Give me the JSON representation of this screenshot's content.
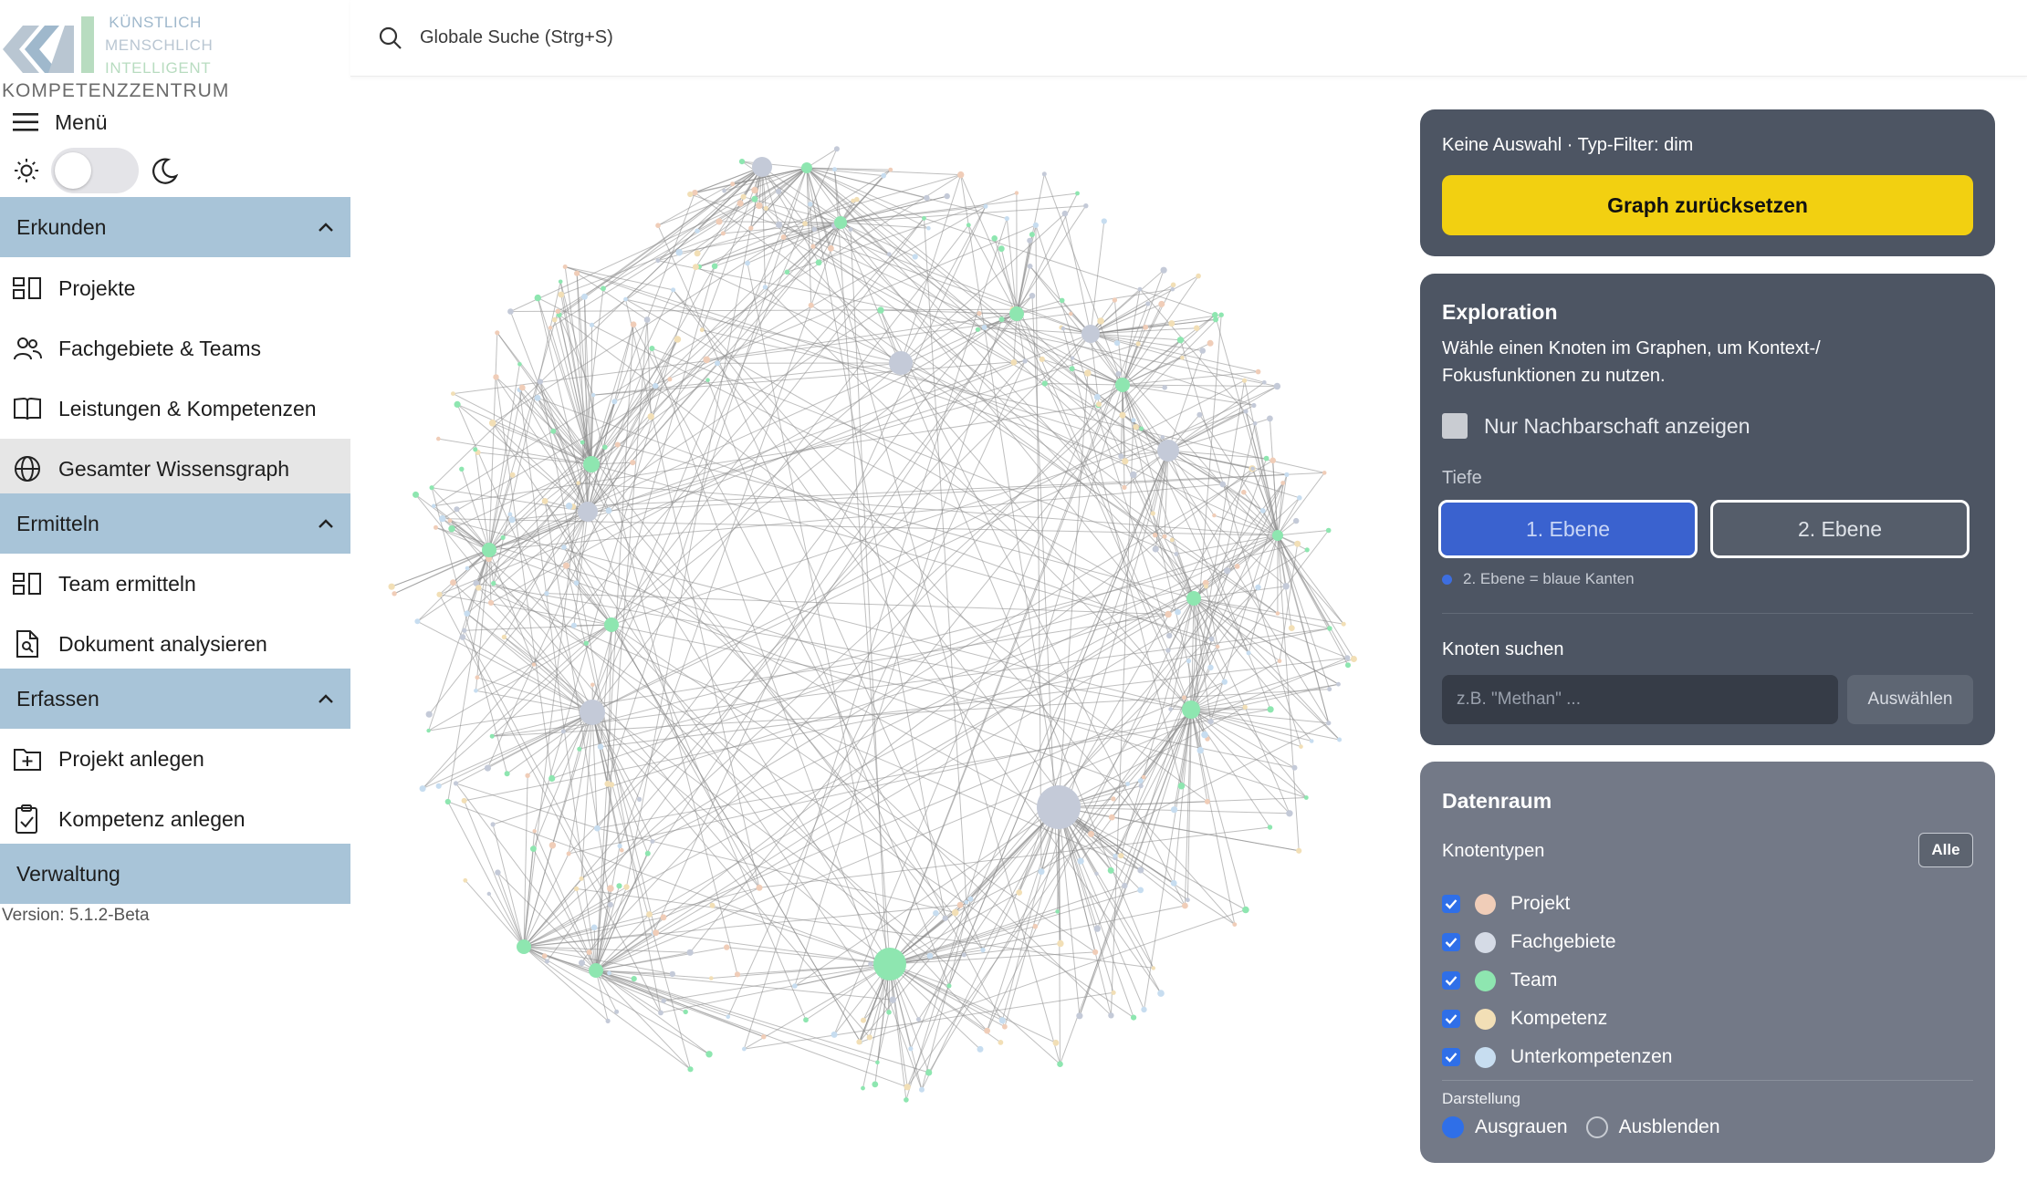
{
  "brand": {
    "logo_text": "KMI",
    "tagline": [
      "KÜNSTLICH",
      "MENSCHLICH",
      "INTELLIGENT"
    ],
    "subtitle": "KOMPETENZZENTRUM"
  },
  "sidebar": {
    "menu_label": "Menü",
    "theme": {
      "light_icon": "sun-icon",
      "dark_icon": "moon-icon",
      "dark_mode": false
    },
    "sections": [
      {
        "title": "Erkunden",
        "items": [
          {
            "label": "Projekte",
            "icon": "grid-icon"
          },
          {
            "label": "Fachgebiete & Teams",
            "icon": "users-icon"
          },
          {
            "label": "Leistungen & Kompetenzen",
            "icon": "book-icon"
          },
          {
            "label": "Gesamter Wissensgraph",
            "icon": "globe-icon",
            "active": true
          }
        ]
      },
      {
        "title": "Ermitteln",
        "items": [
          {
            "label": "Team ermitteln",
            "icon": "grid-icon"
          },
          {
            "label": "Dokument analysieren",
            "icon": "document-search-icon"
          }
        ]
      },
      {
        "title": "Erfassen",
        "items": [
          {
            "label": "Projekt anlegen",
            "icon": "folder-plus-icon"
          },
          {
            "label": "Kompetenz anlegen",
            "icon": "clipboard-check-icon"
          }
        ]
      },
      {
        "title": "Verwaltung",
        "items": []
      }
    ],
    "version": "Version: 5.1.2-Beta"
  },
  "search": {
    "placeholder": "Globale Suche (Strg+S)"
  },
  "status": {
    "text": "Keine Auswahl · Typ-Filter: dim",
    "reset_label": "Graph zurücksetzen"
  },
  "exploration": {
    "title": "Exploration",
    "description": "Wähle einen Knoten im Graphen, um Kontext-/ Fokusfunktionen zu nutzen.",
    "neighborhood_label": "Nur Nachbarschaft anzeigen",
    "neighborhood_checked": false,
    "depth_label": "Tiefe",
    "level1": "1. Ebene",
    "level2": "2. Ebene",
    "hint": "2. Ebene = blaue Kanten",
    "node_search_label": "Knoten suchen",
    "node_search_placeholder": "z.B. \"Methan\" ...",
    "select_label": "Auswählen"
  },
  "dataspace": {
    "title": "Datenraum",
    "node_types_label": "Knotentypen",
    "all_label": "Alle",
    "types": [
      {
        "label": "Projekt",
        "color": "#f0cdb8",
        "checked": true
      },
      {
        "label": "Fachgebiete",
        "color": "#d5dbe6",
        "checked": true
      },
      {
        "label": "Team",
        "color": "#8ee6b0",
        "checked": true
      },
      {
        "label": "Kompetenz",
        "color": "#f2dfb6",
        "checked": true
      },
      {
        "label": "Unterkompetenzen",
        "color": "#c7ddf0",
        "checked": true
      }
    ],
    "display_label": "Darstellung",
    "display_options": [
      {
        "label": "Ausgrauen",
        "selected": true
      },
      {
        "label": "Ausblenden",
        "selected": false
      }
    ]
  },
  "graph": {
    "node_colors": {
      "projekt": "#f0cdb8",
      "fachgebiet": "#c4cad8",
      "team": "#8ee6b0",
      "kompetenz": "#f2dfb6",
      "unterkompetenz": "#c7ddf0",
      "edge": "#8a8a8a"
    }
  }
}
